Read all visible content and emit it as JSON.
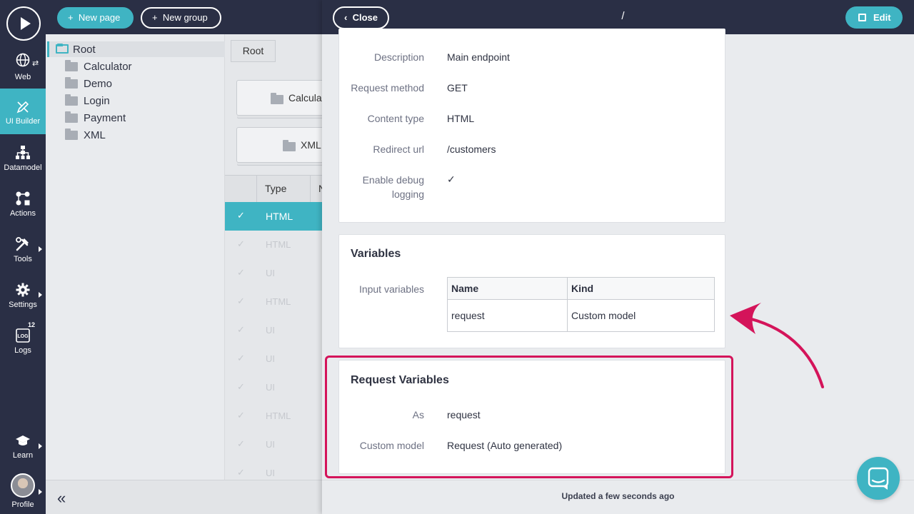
{
  "nav": {
    "items": [
      {
        "label": "Web",
        "icon": "globe-icon"
      },
      {
        "label": "UI Builder",
        "icon": "pencil-ruler-icon"
      },
      {
        "label": "Datamodel",
        "icon": "sitemap-icon"
      },
      {
        "label": "Actions",
        "icon": "actions-icon"
      },
      {
        "label": "Tools",
        "icon": "tools-icon"
      },
      {
        "label": "Settings",
        "icon": "gear-icon"
      },
      {
        "label": "Logs",
        "icon": "log-icon",
        "badge": "12"
      },
      {
        "label": "Learn",
        "icon": "graduation-cap-icon"
      },
      {
        "label": "Profile",
        "icon": "avatar"
      }
    ]
  },
  "topbar": {
    "new_page": "New page",
    "new_group": "New group"
  },
  "tree": {
    "root": "Root",
    "items": [
      "Calculator",
      "Demo",
      "Login",
      "Payment",
      "XML"
    ]
  },
  "list": {
    "breadcrumb": "Root",
    "cards": [
      "Calculat",
      "XML"
    ],
    "columns": [
      "Type",
      "N"
    ],
    "rows": [
      {
        "check": "✓",
        "type": "HTML"
      },
      {
        "check": "✓",
        "type": "HTML"
      },
      {
        "check": "✓",
        "type": "UI"
      },
      {
        "check": "✓",
        "type": "HTML"
      },
      {
        "check": "✓",
        "type": "UI"
      },
      {
        "check": "✓",
        "type": "UI"
      },
      {
        "check": "✓",
        "type": "UI"
      },
      {
        "check": "✓",
        "type": "HTML"
      },
      {
        "check": "✓",
        "type": "UI"
      },
      {
        "check": "✓",
        "type": "UI"
      }
    ]
  },
  "detail": {
    "close": "Close",
    "title": "/",
    "edit": "Edit",
    "general": {
      "description_label": "Description",
      "description": "Main endpoint",
      "method_label": "Request method",
      "method": "GET",
      "content_type_label": "Content type",
      "content_type": "HTML",
      "redirect_label": "Redirect url",
      "redirect": "/customers",
      "debug_label_1": "Enable debug",
      "debug_label_2": "logging",
      "debug": "✓"
    },
    "variables": {
      "title": "Variables",
      "input_label": "Input variables",
      "col_name": "Name",
      "col_kind": "Kind",
      "row_name": "request",
      "row_kind": "Custom model"
    },
    "request_variables": {
      "title": "Request Variables",
      "as_label": "As",
      "as": "request",
      "model_label": "Custom model",
      "model": "Request (Auto generated)"
    },
    "updated": "Updated a few seconds ago"
  },
  "colors": {
    "nav_bg": "#2a2f45",
    "accent": "#3fb4c3",
    "highlight": "#d4145a"
  }
}
